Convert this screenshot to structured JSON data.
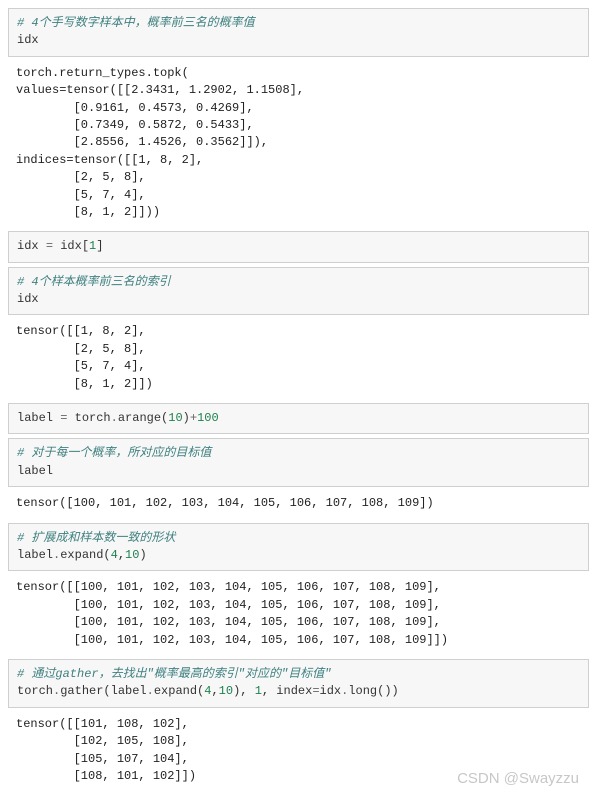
{
  "cells": [
    {
      "in_html": "<span class='c-comment'># 4个手写数字样本中，概率前三名的概率值</span>\nidx",
      "out": "torch.return_types.topk(\nvalues=tensor([[2.3431, 1.2902, 1.1508],\n        [0.9161, 0.4573, 0.4269],\n        [0.7349, 0.5872, 0.5433],\n        [2.8556, 1.4526, 0.3562]]),\nindices=tensor([[1, 8, 2],\n        [2, 5, 8],\n        [5, 7, 4],\n        [8, 1, 2]]))"
    },
    {
      "in_html": "idx <span class='c-op'>=</span> idx[<span class='c-num'>1</span>]",
      "out": ""
    },
    {
      "in_html": "<span class='c-comment'># 4个样本概率前三名的索引</span>\nidx",
      "out": "tensor([[1, 8, 2],\n        [2, 5, 8],\n        [5, 7, 4],\n        [8, 1, 2]])"
    },
    {
      "in_html": "label <span class='c-op'>=</span> torch<span class='c-op'>.</span>arange(<span class='c-num'>10</span>)<span class='c-op'>+</span><span class='c-num'>100</span>",
      "out": ""
    },
    {
      "in_html": "<span class='c-comment'># 对于每一个概率，所对应的目标值</span>\nlabel",
      "out": "tensor([100, 101, 102, 103, 104, 105, 106, 107, 108, 109])"
    },
    {
      "in_html": "<span class='c-comment'># 扩展成和样本数一致的形状</span>\nlabel<span class='c-op'>.</span>expand(<span class='c-num'>4</span>,<span class='c-num'>10</span>)",
      "out": "tensor([[100, 101, 102, 103, 104, 105, 106, 107, 108, 109],\n        [100, 101, 102, 103, 104, 105, 106, 107, 108, 109],\n        [100, 101, 102, 103, 104, 105, 106, 107, 108, 109],\n        [100, 101, 102, 103, 104, 105, 106, 107, 108, 109]])"
    },
    {
      "in_html": "<span class='c-comment'># 通过gather，去找出\"概率最高的索引\"对应的\"目标值\"</span>\ntorch<span class='c-op'>.</span>gather(label<span class='c-op'>.</span>expand(<span class='c-num'>4</span>,<span class='c-num'>10</span>), <span class='c-num'>1</span>, index<span class='c-op'>=</span>idx<span class='c-op'>.</span>long())",
      "out": "tensor([[101, 108, 102],\n        [102, 105, 108],\n        [105, 107, 104],\n        [108, 101, 102]])"
    }
  ],
  "watermark": "CSDN @Swayzzu"
}
